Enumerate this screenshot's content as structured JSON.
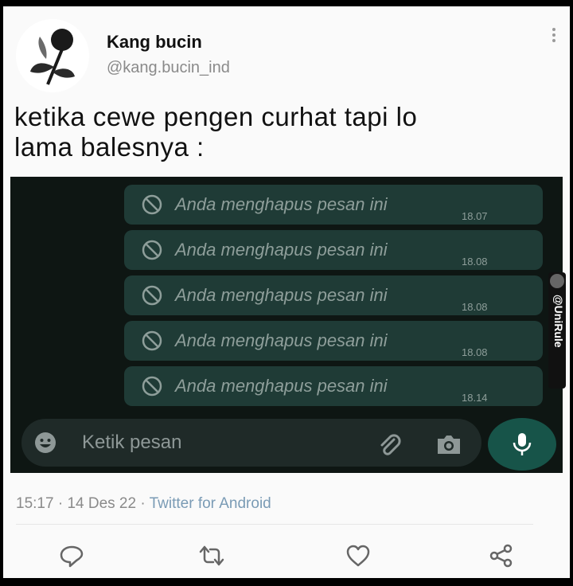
{
  "author": {
    "name": "Kang bucin",
    "handle": "@kang.bucin_ind"
  },
  "tweet": {
    "line1": "ketika cewe pengen curhat tapi lo",
    "line2": "lama balesnya :"
  },
  "chat": {
    "messages": [
      {
        "text": "Anda menghapus pesan ini",
        "time": "18.07"
      },
      {
        "text": "Anda menghapus pesan ini",
        "time": "18.08"
      },
      {
        "text": "Anda menghapus pesan ini",
        "time": "18.08"
      },
      {
        "text": "Anda menghapus pesan ini",
        "time": "18.08"
      },
      {
        "text": "Anda menghapus pesan ini",
        "time": "18.14"
      }
    ],
    "input_placeholder": "Ketik pesan",
    "watermark": "@UniRule"
  },
  "meta": {
    "time": "15:17",
    "date": "14 Des 22",
    "source": "Twitter for Android",
    "sep": "·"
  },
  "colors": {
    "chat_bg": "#0e1613",
    "bubble": "#1f3b36",
    "mic": "#175449",
    "link": "#7a9bb5"
  },
  "icons": [
    "more-vertical-icon",
    "blocked-icon",
    "emoji-icon",
    "attach-icon",
    "camera-icon",
    "mic-icon",
    "reply-icon",
    "retweet-icon",
    "like-icon",
    "share-icon"
  ]
}
